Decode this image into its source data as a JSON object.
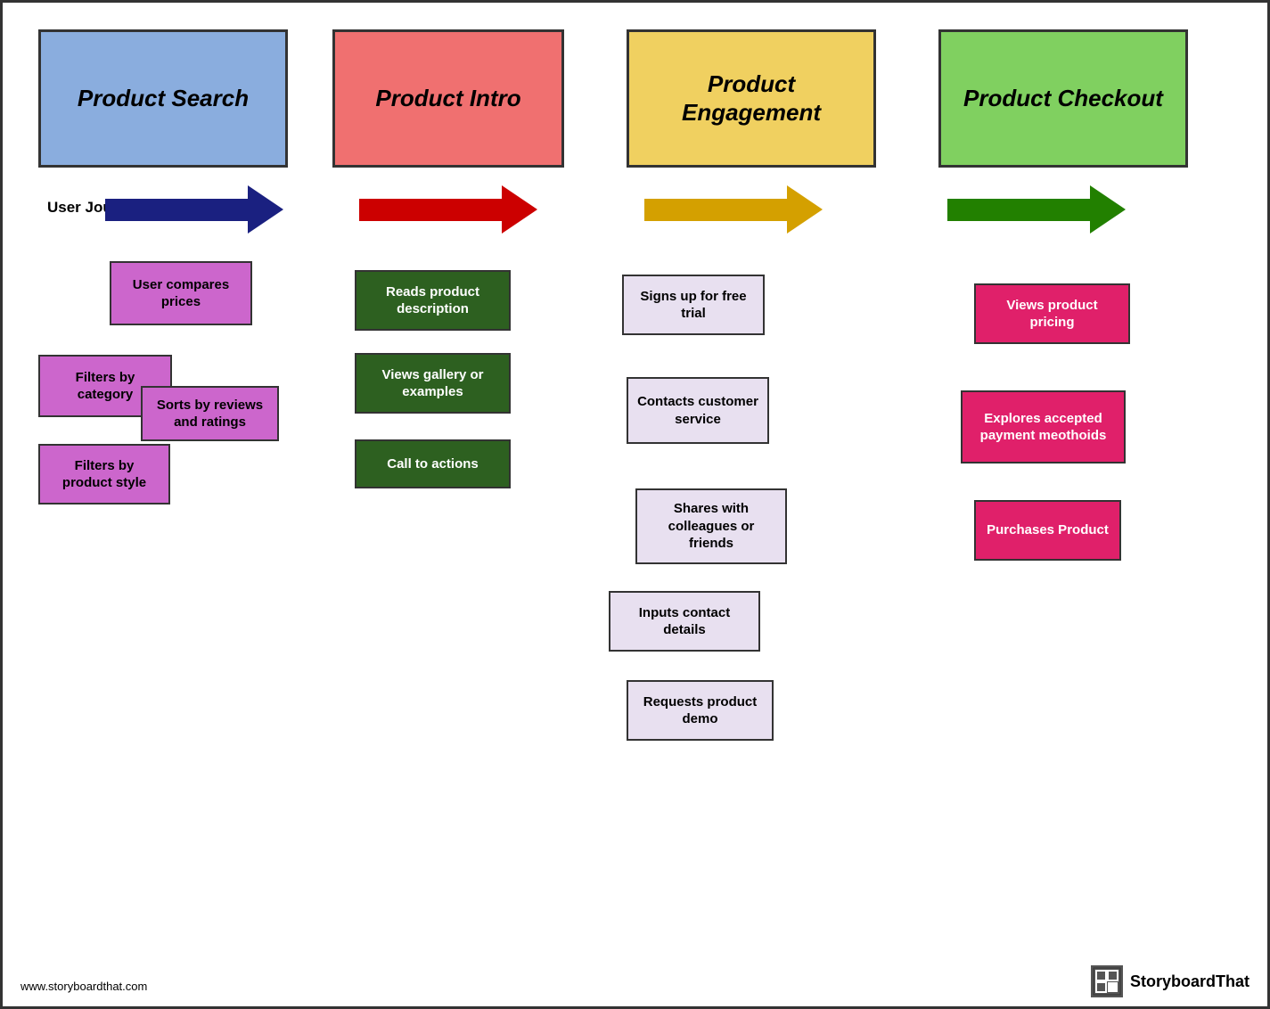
{
  "columns": [
    {
      "id": "col1",
      "title": "Product Search",
      "bg": "#8aadde",
      "arrow_color": "#1a2080"
    },
    {
      "id": "col2",
      "title": "Product Intro",
      "bg": "#f07070",
      "arrow_color": "#cc0000"
    },
    {
      "id": "col3",
      "title": "Product Engagement",
      "bg": "#f0d060",
      "arrow_color": "#d4a000"
    },
    {
      "id": "col4",
      "title": "Product Checkout",
      "bg": "#80d060",
      "arrow_color": "#228000"
    }
  ],
  "journey_label": "User Journey",
  "cards": {
    "col1": [
      {
        "id": "user-compares",
        "text": "User compares prices"
      },
      {
        "id": "filters-category",
        "text": "Filters by category"
      },
      {
        "id": "sorts-reviews",
        "text": "Sorts by reviews and ratings"
      },
      {
        "id": "filters-style",
        "text": "Filters by product style"
      }
    ],
    "col2": [
      {
        "id": "reads-desc",
        "text": "Reads product description"
      },
      {
        "id": "views-gallery",
        "text": "Views gallery or examples"
      },
      {
        "id": "call-actions",
        "text": "Call to actions"
      }
    ],
    "col3": [
      {
        "id": "signs-up",
        "text": "Signs up for free trial"
      },
      {
        "id": "contacts-service",
        "text": "Contacts customer service"
      },
      {
        "id": "shares",
        "text": "Shares with colleagues or friends"
      },
      {
        "id": "inputs-contact",
        "text": "Inputs contact details"
      },
      {
        "id": "requests-demo",
        "text": "Requests product demo"
      }
    ],
    "col4": [
      {
        "id": "views-pricing",
        "text": "Views product pricing"
      },
      {
        "id": "explores-payment",
        "text": "Explores accepted payment meothoids"
      },
      {
        "id": "purchases",
        "text": "Purchases Product"
      }
    ]
  },
  "footer": {
    "website": "www.storyboardthat.com",
    "logo_text": "StoryboardThat"
  }
}
